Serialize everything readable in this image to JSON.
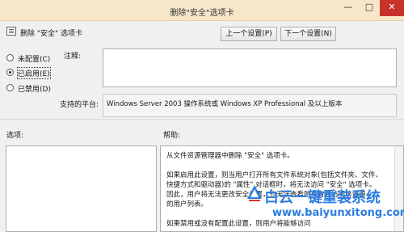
{
  "window": {
    "title": "删除\"安全\"选项卡",
    "minimize_glyph": "—",
    "maximize_glyph": "□",
    "close_glyph": "✕"
  },
  "policy": {
    "name": "删除 \"安全\" 选项卡"
  },
  "nav": {
    "prev_label": "上一个设置(P)",
    "next_label": "下一个设置(N)"
  },
  "state": {
    "options": [
      {
        "label": "未配置(C)",
        "selected": false
      },
      {
        "label": "已启用(E)",
        "selected": true
      },
      {
        "label": "已禁用(D)",
        "selected": false
      }
    ]
  },
  "comment": {
    "label": "注释:",
    "value": ""
  },
  "platform": {
    "label": "支持的平台:",
    "value": "Windows Server 2003 操作系统或 Windows XP Professional 及以上版本"
  },
  "options_panel": {
    "label": "选项:"
  },
  "help_panel": {
    "label": "帮助:",
    "lines": [
      "从文件资源管理器中删除 \"安全\" 选项卡。",
      "",
      "如果启用此设置，则当用户打开所有文件系统对象(包括文件夹、文件、",
      "快捷方式和驱动器)的 \"属性\" 对话框时，将无法访问 \"安全\" 选项卡。",
      "因此，用户将无法更改安全设置，也无法查看所有有权访问该资源",
      "的用户列表。",
      "",
      "如果禁用或没有配置此设置，则用户将能够访问"
    ]
  },
  "watermark": {
    "brand": "白云一键重装系统",
    "url": "www.baiyunxitong.com"
  },
  "colors": {
    "titlebar": "#f7e7c9",
    "close": "#c7322b",
    "watermark_blue": "#2b7de0"
  }
}
